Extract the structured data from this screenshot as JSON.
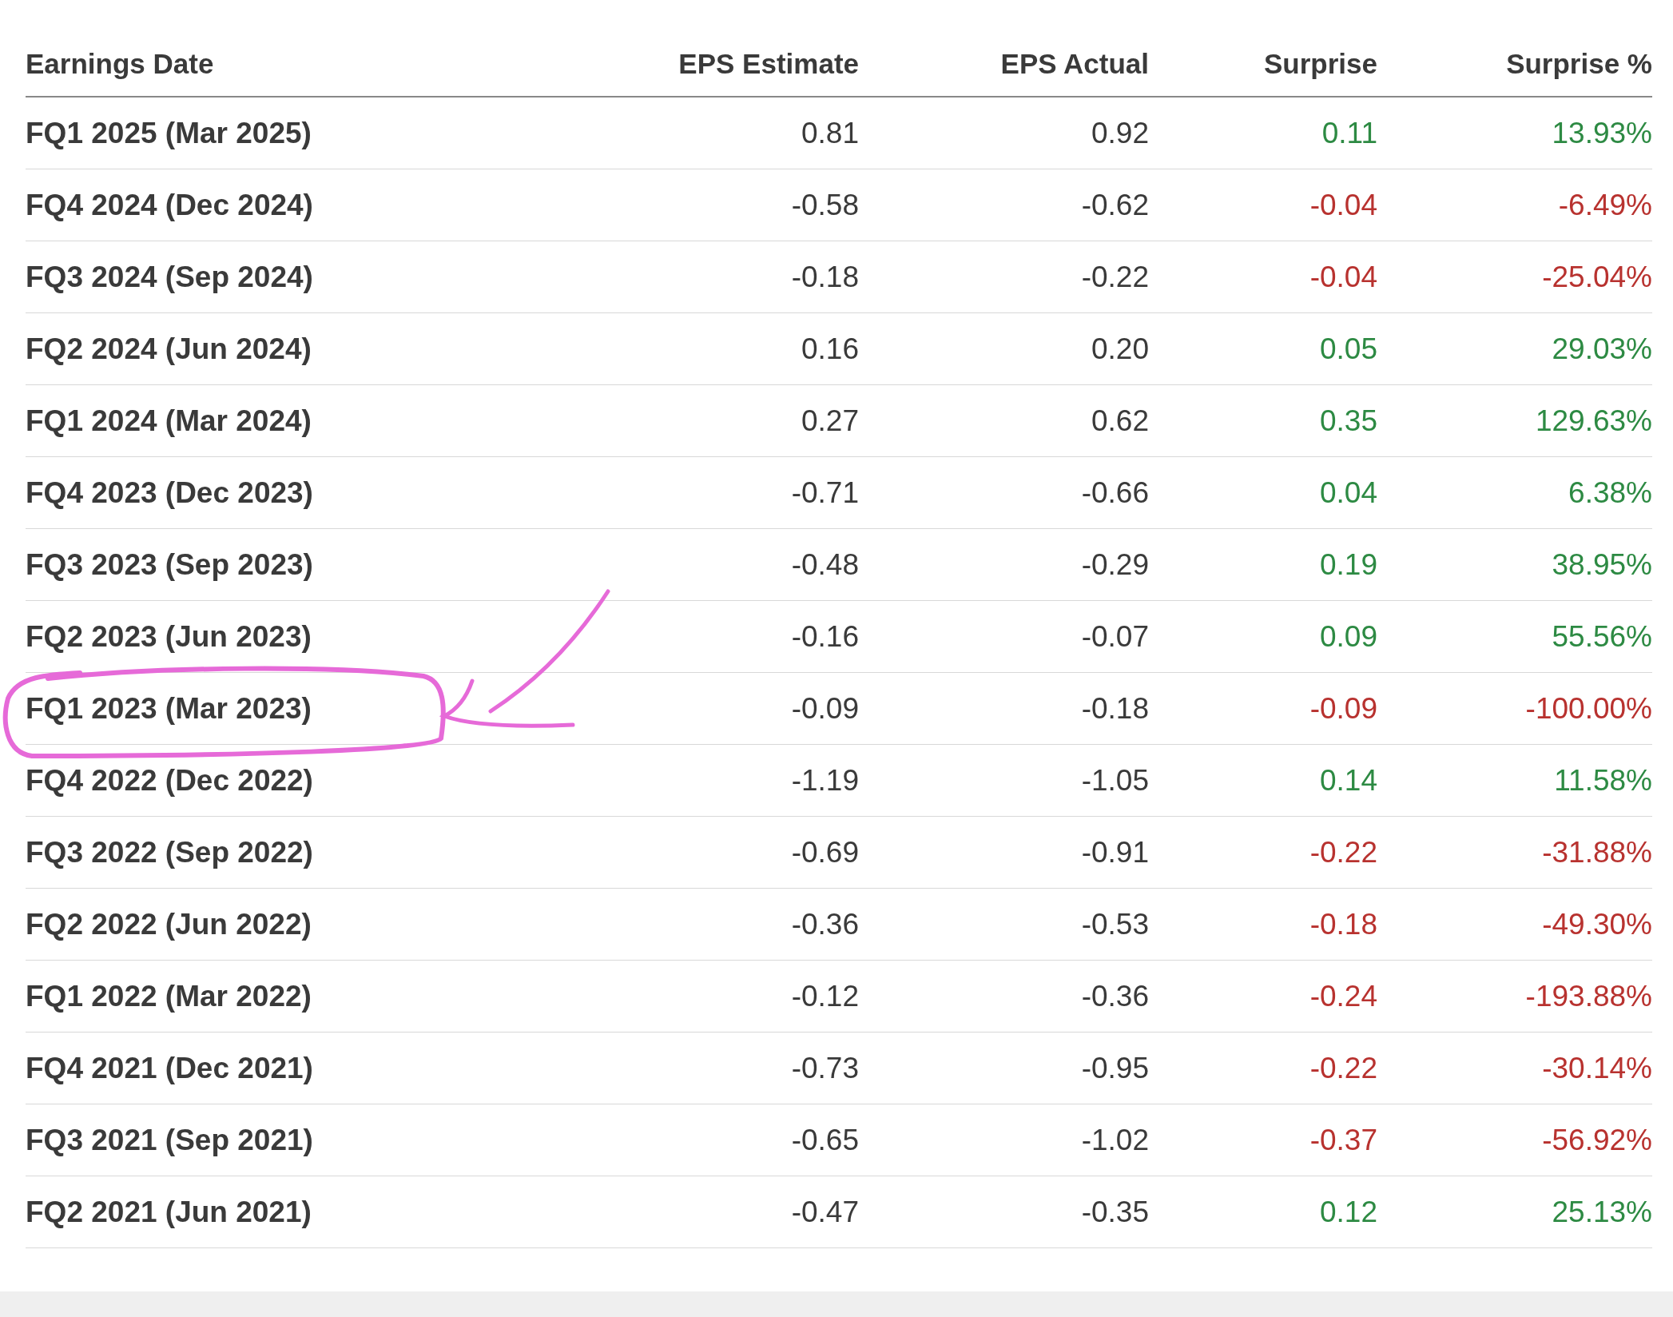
{
  "table": {
    "columns": [
      "Earnings Date",
      "EPS Estimate",
      "EPS Actual",
      "Surprise",
      "Surprise %"
    ],
    "rows": [
      {
        "date": "FQ1 2025 (Mar 2025)",
        "estimate": "0.81",
        "actual": "0.92",
        "surprise": "0.11",
        "surprise_pct": "13.93%",
        "positive": true,
        "highlighted": false
      },
      {
        "date": "FQ4 2024 (Dec 2024)",
        "estimate": "-0.58",
        "actual": "-0.62",
        "surprise": "-0.04",
        "surprise_pct": "-6.49%",
        "positive": false,
        "highlighted": false
      },
      {
        "date": "FQ3 2024 (Sep 2024)",
        "estimate": "-0.18",
        "actual": "-0.22",
        "surprise": "-0.04",
        "surprise_pct": "-25.04%",
        "positive": false,
        "highlighted": false
      },
      {
        "date": "FQ2 2024 (Jun 2024)",
        "estimate": "0.16",
        "actual": "0.20",
        "surprise": "0.05",
        "surprise_pct": "29.03%",
        "positive": true,
        "highlighted": false
      },
      {
        "date": "FQ1 2024 (Mar 2024)",
        "estimate": "0.27",
        "actual": "0.62",
        "surprise": "0.35",
        "surprise_pct": "129.63%",
        "positive": true,
        "highlighted": false
      },
      {
        "date": "FQ4 2023 (Dec 2023)",
        "estimate": "-0.71",
        "actual": "-0.66",
        "surprise": "0.04",
        "surprise_pct": "6.38%",
        "positive": true,
        "highlighted": false
      },
      {
        "date": "FQ3 2023 (Sep 2023)",
        "estimate": "-0.48",
        "actual": "-0.29",
        "surprise": "0.19",
        "surprise_pct": "38.95%",
        "positive": true,
        "highlighted": false
      },
      {
        "date": "FQ2 2023 (Jun 2023)",
        "estimate": "-0.16",
        "actual": "-0.07",
        "surprise": "0.09",
        "surprise_pct": "55.56%",
        "positive": true,
        "highlighted": false
      },
      {
        "date": "FQ1 2023 (Mar 2023)",
        "estimate": "-0.09",
        "actual": "-0.18",
        "surprise": "-0.09",
        "surprise_pct": "-100.00%",
        "positive": false,
        "highlighted": true
      },
      {
        "date": "FQ4 2022 (Dec 2022)",
        "estimate": "-1.19",
        "actual": "-1.05",
        "surprise": "0.14",
        "surprise_pct": "11.58%",
        "positive": true,
        "highlighted": false
      },
      {
        "date": "FQ3 2022 (Sep 2022)",
        "estimate": "-0.69",
        "actual": "-0.91",
        "surprise": "-0.22",
        "surprise_pct": "-31.88%",
        "positive": false,
        "highlighted": false
      },
      {
        "date": "FQ2 2022 (Jun 2022)",
        "estimate": "-0.36",
        "actual": "-0.53",
        "surprise": "-0.18",
        "surprise_pct": "-49.30%",
        "positive": false,
        "highlighted": false
      },
      {
        "date": "FQ1 2022 (Mar 2022)",
        "estimate": "-0.12",
        "actual": "-0.36",
        "surprise": "-0.24",
        "surprise_pct": "-193.88%",
        "positive": false,
        "highlighted": false
      },
      {
        "date": "FQ4 2021 (Dec 2021)",
        "estimate": "-0.73",
        "actual": "-0.95",
        "surprise": "-0.22",
        "surprise_pct": "-30.14%",
        "positive": false,
        "highlighted": false
      },
      {
        "date": "FQ3 2021 (Sep 2021)",
        "estimate": "-0.65",
        "actual": "-1.02",
        "surprise": "-0.37",
        "surprise_pct": "-56.92%",
        "positive": false,
        "highlighted": false
      },
      {
        "date": "FQ2 2021 (Jun 2021)",
        "estimate": "-0.47",
        "actual": "-0.35",
        "surprise": "0.12",
        "surprise_pct": "25.13%",
        "positive": true,
        "highlighted": false
      }
    ]
  }
}
